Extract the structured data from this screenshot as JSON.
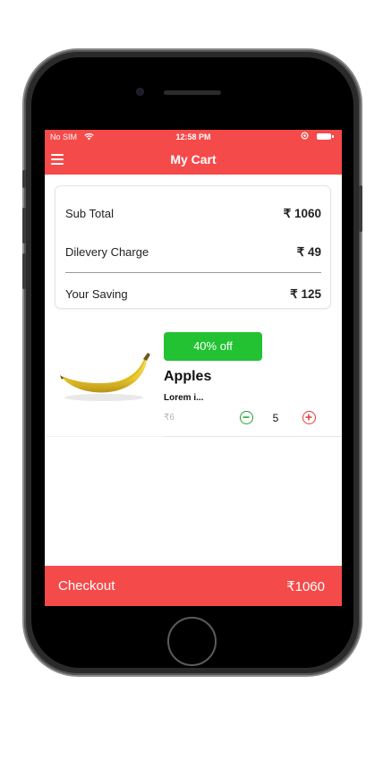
{
  "status_bar": {
    "carrier": "No SIM",
    "time": "12:58 PM"
  },
  "nav": {
    "title": "My Cart"
  },
  "summary": {
    "sub_total_label": "Sub Total",
    "sub_total_value": "₹ 1060",
    "delivery_label": "Dilevery Charge",
    "delivery_value": "₹ 49",
    "saving_label": "Your Saving",
    "saving_value": "₹ 125"
  },
  "product": {
    "discount": "40% off",
    "name": "Apples",
    "description": "Lorem i...",
    "price": "₹6",
    "quantity": "5",
    "image_icon": "banana-image"
  },
  "checkout": {
    "label": "Checkout",
    "total": "₹1060"
  },
  "colors": {
    "primary_red": "#f54a4a",
    "discount_green": "#22c232",
    "minus_green": "#1fa12e",
    "plus_red": "#e23a3a"
  }
}
